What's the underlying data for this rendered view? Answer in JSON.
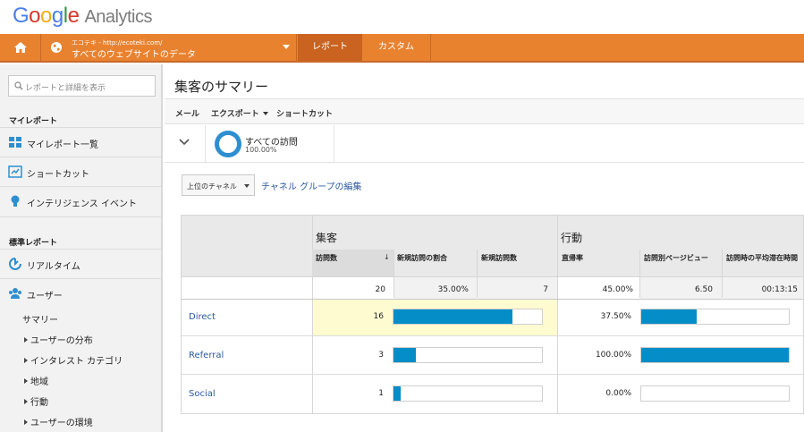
{
  "header": {
    "brand": "Google",
    "product": "Analytics",
    "account_line1": "エコテキ - http://ecoteki.com/",
    "account_line2": "すべてのウェブサイトのデータ",
    "tab_reports": "レポート",
    "tab_custom": "カスタム"
  },
  "sidebar": {
    "search_placeholder": "レポートと詳細を表示",
    "section_my": "マイレポート",
    "my_items": [
      {
        "label": "マイレポート一覧",
        "icon": "dashboard-icon"
      },
      {
        "label": "ショートカット",
        "icon": "shortcut-icon"
      },
      {
        "label": "インテリジェンス イベント",
        "icon": "lightbulb-icon"
      }
    ],
    "section_std": "標準レポート",
    "std_items": [
      {
        "label": "リアルタイム",
        "icon": "realtime-icon"
      },
      {
        "label": "ユーザー",
        "icon": "users-icon"
      }
    ],
    "sub_items": [
      "サマリー",
      "ユーザーの分布",
      "インタレスト カテゴリ",
      "地域",
      "行動",
      "ユーザーの環境"
    ]
  },
  "main": {
    "title": "集客のサマリー",
    "toolbar": {
      "mail": "メール",
      "export": "エクスポート",
      "shortcut": "ショートカット"
    },
    "segment": {
      "name": "すべての訪問",
      "percent": "100.00%"
    },
    "channel_select": "上位のチャネル",
    "edit_link": "チャネル グループの編集"
  },
  "table": {
    "group_acquisition": "集客",
    "group_behavior": "行動",
    "columns": [
      "訪問数",
      "新規訪問の割合",
      "新規訪問数",
      "直帰率",
      "訪問別ページビュー",
      "訪問時の平均滞在時間"
    ],
    "totals": [
      "20",
      "35.00%",
      "7",
      "45.00%",
      "6.50",
      "00:13:15"
    ],
    "rows": [
      {
        "channel": "Direct",
        "sessions": "16",
        "sessions_bar": 0.8,
        "bounce": "37.50%",
        "bounce_bar": 0.375
      },
      {
        "channel": "Referral",
        "sessions": "3",
        "sessions_bar": 0.15,
        "bounce": "100.00%",
        "bounce_bar": 1.0
      },
      {
        "channel": "Social",
        "sessions": "1",
        "sessions_bar": 0.05,
        "bounce": "0.00%",
        "bounce_bar": 0.0
      }
    ]
  },
  "colors": {
    "accent_orange": "#e9822f",
    "active_tab": "#c9631f",
    "bar_blue": "#058dc7",
    "highlight": "#fffbd1"
  }
}
